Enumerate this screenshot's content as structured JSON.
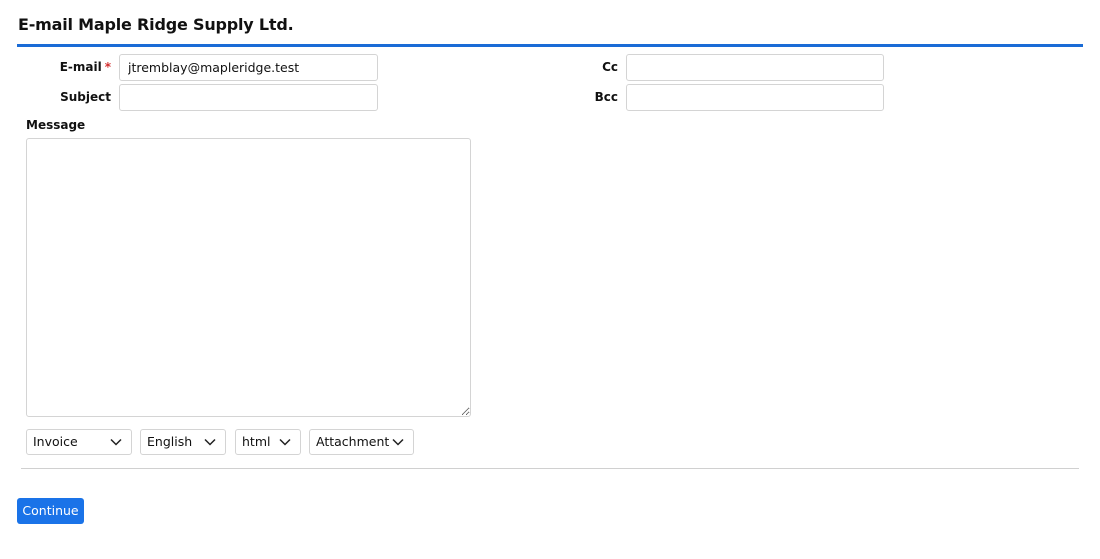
{
  "header": {
    "title": "E-mail Maple Ridge Supply Ltd."
  },
  "form": {
    "email": {
      "label": "E-mail",
      "required_mark": "*",
      "value": "jtremblay@mapleridge.test"
    },
    "subject": {
      "label": "Subject",
      "value": ""
    },
    "cc": {
      "label": "Cc",
      "value": ""
    },
    "bcc": {
      "label": "Bcc",
      "value": ""
    },
    "message": {
      "label": "Message",
      "value": ""
    }
  },
  "options": {
    "template": {
      "selected": "Invoice"
    },
    "language": {
      "selected": "English"
    },
    "format": {
      "selected": "html"
    },
    "attachment": {
      "selected": "Attachment"
    }
  },
  "actions": {
    "continue_label": "Continue"
  },
  "colors": {
    "accent": "#1a6bd6",
    "button": "#1a73e8",
    "required": "#d32f2f"
  },
  "icons": {
    "dropdown": "chevron-down-icon"
  }
}
